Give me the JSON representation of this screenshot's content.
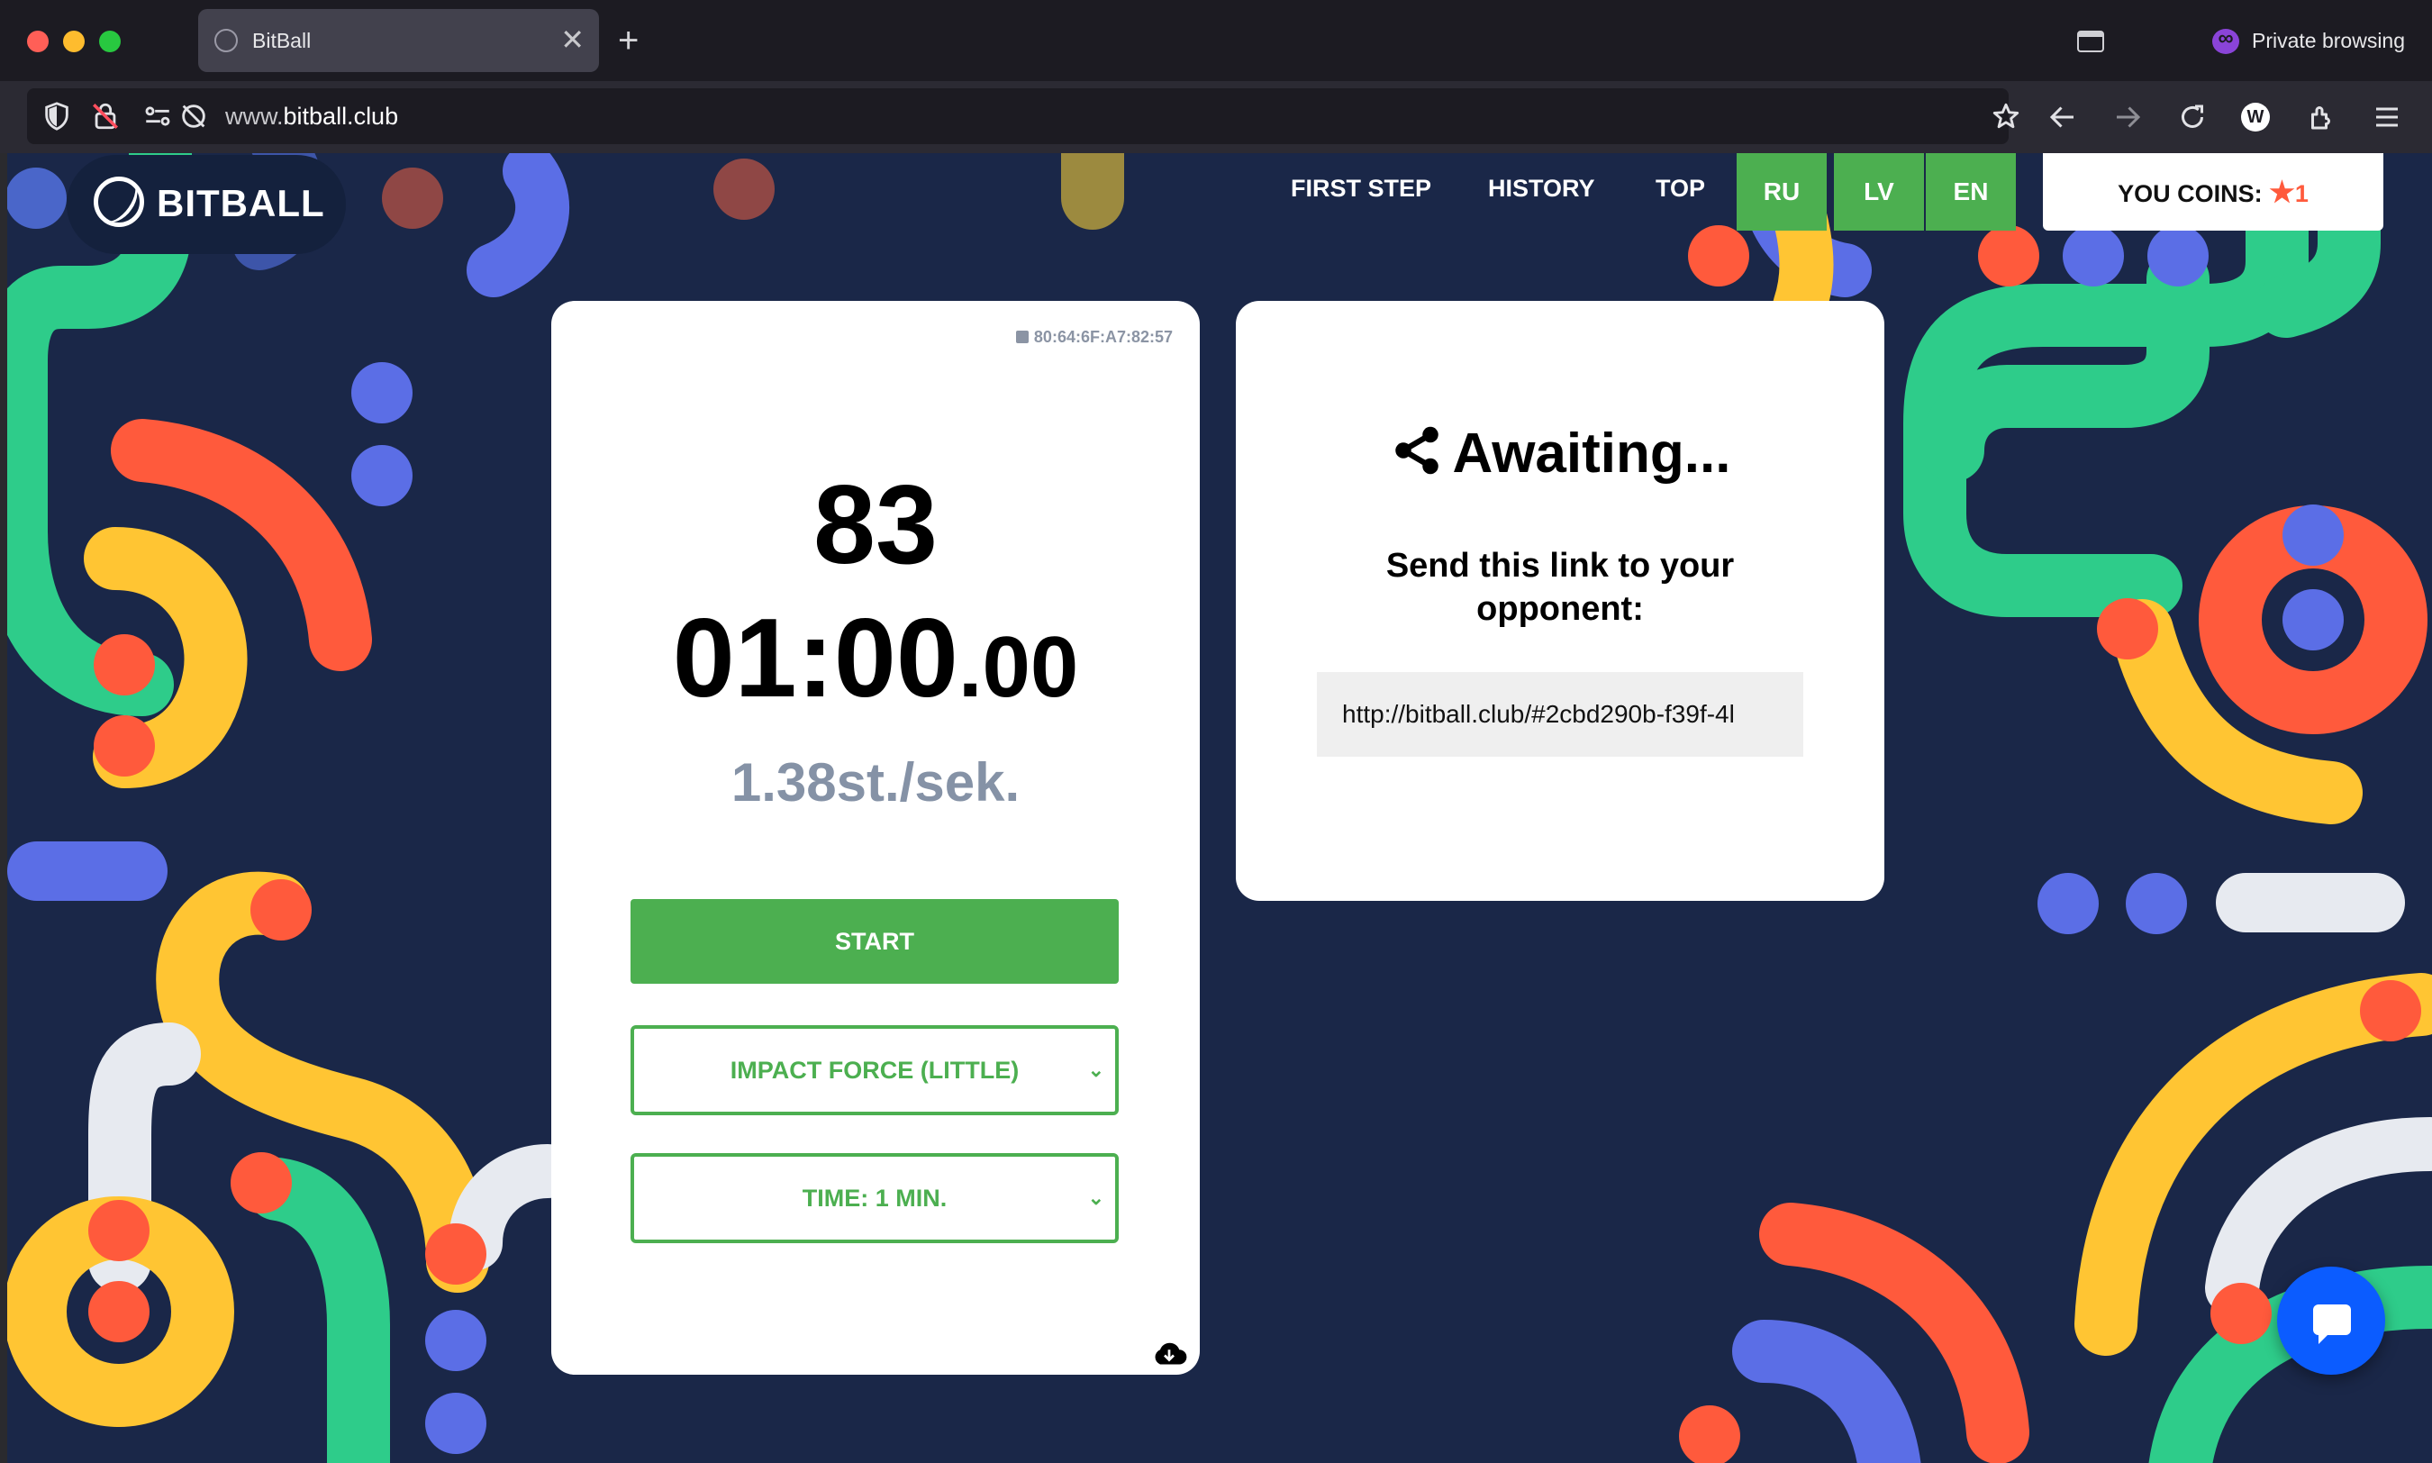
{
  "browser": {
    "tab_title": "BitBall",
    "tab_close": "✕",
    "new_tab": "+",
    "url_host_prefix": "www.",
    "url_host": "bitball.club",
    "private_label": "Private browsing",
    "icons": [
      "shield-icon",
      "lock-slash-icon",
      "permissions-icon",
      "tracking-off-icon",
      "star-icon",
      "back-icon",
      "forward-icon",
      "reload-icon",
      "account-icon",
      "extensions-icon",
      "menu-icon"
    ]
  },
  "site": {
    "logo": "BITBALL",
    "nav": [
      "FIRST STEP",
      "HISTORY",
      "TOP"
    ],
    "languages": [
      "RU",
      "LV",
      "EN"
    ],
    "coins_label": "YOU COINS:",
    "coins_star": "★",
    "coins_value": "1"
  },
  "game": {
    "device_id": "80:64:6F:A7:82:57",
    "score": "83",
    "timer_main": "01:00",
    "timer_ms": ".00",
    "rate": "1.38st./sek.",
    "start_label": "START",
    "impact_select": "IMPACT FORCE (LITTLE)",
    "time_select": "TIME: 1 MIN.",
    "chevron": "⌄"
  },
  "invite": {
    "status": "Awaiting...",
    "instruction": "Send this link to your opponent:",
    "link": "http://bitball.club/#2cbd290b-f39f-4l"
  },
  "colors": {
    "page_bg": "#1a2748",
    "green": "#4caf50",
    "orange": "#ff5a3c",
    "yellow": "#ffc533",
    "blue": "#5b6ee6",
    "teal": "#2ecc8a",
    "chat_blue": "#0b5cff"
  }
}
